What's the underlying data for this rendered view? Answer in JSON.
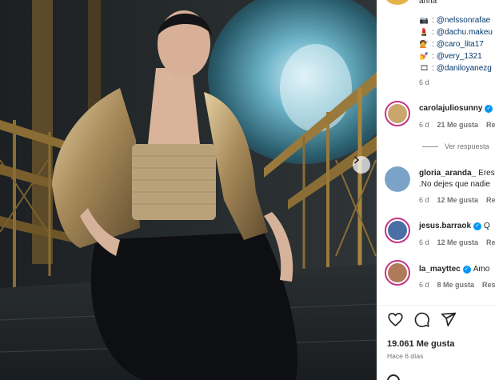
{
  "post": {
    "next_icon": "chevron-right-icon"
  },
  "caption": {
    "partial_top": "arina",
    "tags": [
      {
        "icon": "camera-icon",
        "emoji": "📷",
        "handle": "@nelssonrafae"
      },
      {
        "icon": "lipstick-icon",
        "emoji": "💄",
        "handle": "@dachu.makeu"
      },
      {
        "icon": "hairdresser-icon",
        "emoji": "💇",
        "handle": "@caro_lita17"
      },
      {
        "icon": "nails-icon",
        "emoji": "💅",
        "handle": "@very_1321"
      },
      {
        "icon": "film-icon",
        "emoji": "🎞",
        "handle": "@daniloyanezg"
      }
    ],
    "time": "6 d"
  },
  "comments": [
    {
      "username": "carolajuliosunny",
      "verified": true,
      "text": "",
      "second_line": "",
      "time": "6 d",
      "likes": "21 Me gusta",
      "reply": "Re",
      "avatar_color": "#c9a66b"
    },
    {
      "username": "gloria_aranda_",
      "verified": false,
      "text": "Eres",
      "second_line": ".No dejes que nadie",
      "time": "6 d",
      "likes": "12 Me gusta",
      "reply": "Re",
      "avatar_color": "#7aa3c7"
    },
    {
      "username": "jesus.barraok",
      "verified": true,
      "text": "Q",
      "second_line": "",
      "time": "6 d",
      "likes": "12 Me gusta",
      "reply": "Re",
      "avatar_color": "#4a6fa5"
    },
    {
      "username": "la_mayttec",
      "verified": true,
      "text": "Amo",
      "second_line": "",
      "time": "6 d",
      "likes": "8 Me gusta",
      "reply": "Res",
      "avatar_color": "#b07a5a"
    }
  ],
  "view_replies": "Ver respuesta",
  "actions": {
    "like_icon": "heart-icon",
    "comment_icon": "comment-icon",
    "share_icon": "send-icon"
  },
  "likes_count": "19.061 Me gusta",
  "posted": "Hace 6 días",
  "colors": {
    "link": "#00376b",
    "muted": "#737373",
    "verified": "#0095f6",
    "story_ring": "#c13584"
  }
}
